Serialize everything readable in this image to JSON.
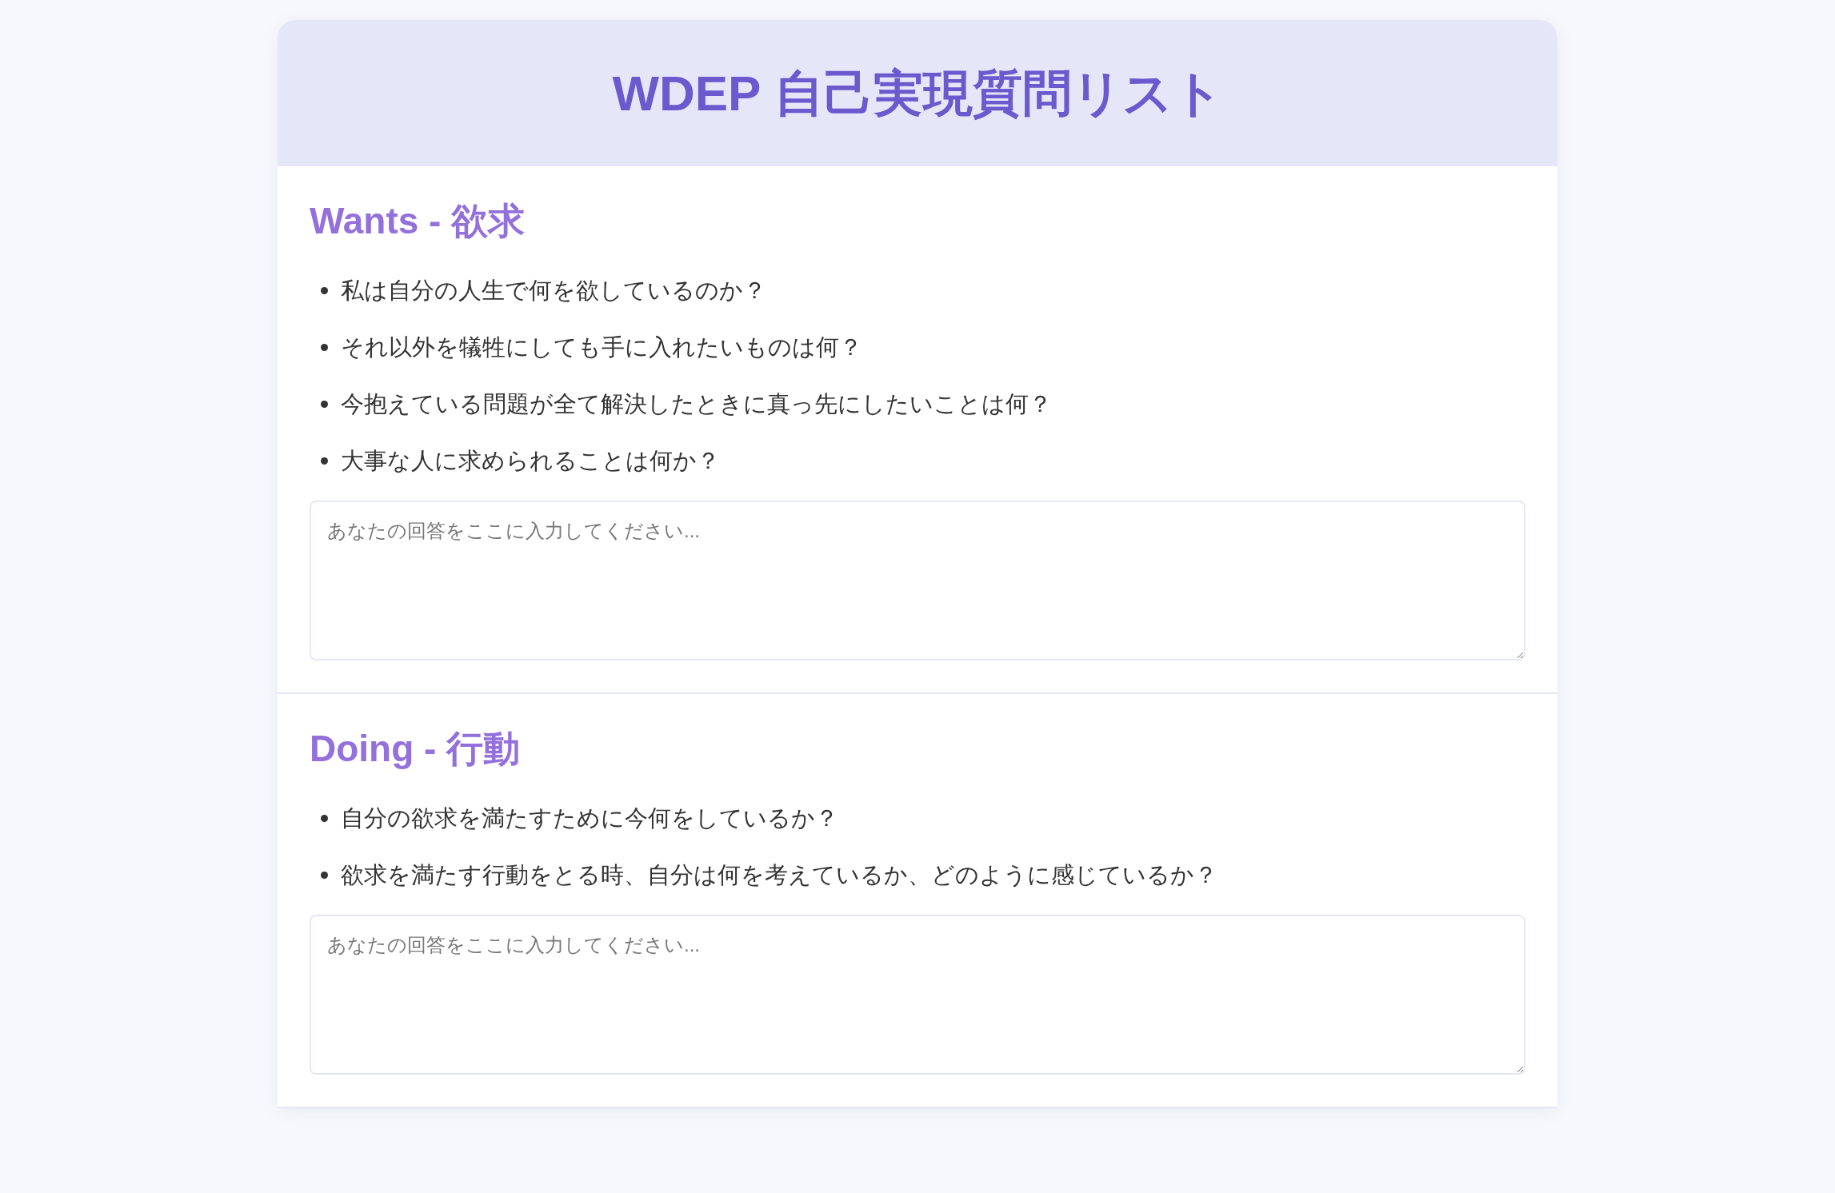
{
  "title": "WDEP 自己実現質問リスト",
  "sections": [
    {
      "heading": "Wants - 欲求",
      "questions": [
        "私は自分の人生で何を欲しているのか？",
        "それ以外を犠牲にしても手に入れたいものは何？",
        "今抱えている問題が全て解決したときに真っ先にしたいことは何？",
        "大事な人に求められることは何か？"
      ],
      "answer": {
        "placeholder": "あなたの回答をここに入力してください..."
      }
    },
    {
      "heading": "Doing - 行動",
      "questions": [
        "自分の欲求を満たすために今何をしているか？",
        "欲求を満たす行動をとる時、自分は何を考えているか、どのように感じているか？"
      ],
      "answer": {
        "placeholder": "あなたの回答をここに入力してください..."
      }
    }
  ]
}
